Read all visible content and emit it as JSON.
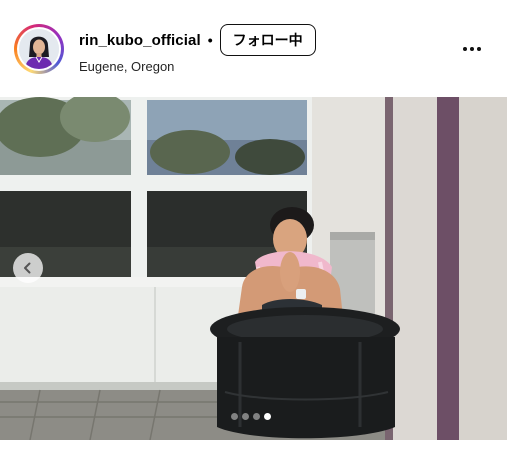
{
  "post_header": {
    "username": "rin_kubo_official",
    "separator": "•",
    "follow_button_label": "フォロー中",
    "location": "Eugene, Oregon",
    "more_icon": "more-horizontal-icon"
  },
  "carousel": {
    "prev_icon": "chevron-left-icon",
    "total_slides": 4,
    "active_slide": 4
  }
}
